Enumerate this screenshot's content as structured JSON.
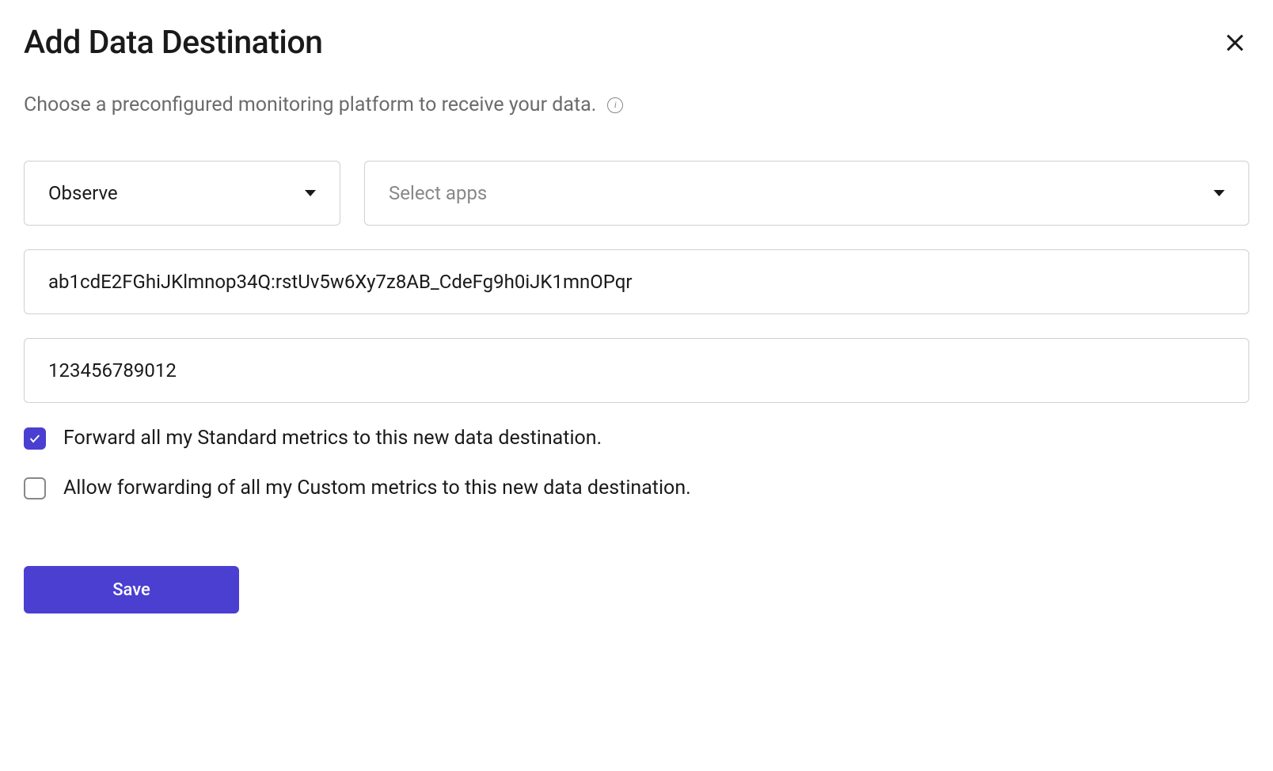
{
  "modal": {
    "title": "Add Data Destination",
    "subtitle": "Choose a preconfigured monitoring platform to receive your data.",
    "platform_select": {
      "value": "Observe"
    },
    "apps_select": {
      "placeholder": "Select apps"
    },
    "api_key_input": {
      "value": "ab1cdE2FGhiJKlmnop34Q:rstUv5w6Xy7z8AB_CdeFg9h0iJK1mnOPqr"
    },
    "account_id_input": {
      "value": "123456789012"
    },
    "checkbox_standard": {
      "label": "Forward all my Standard metrics to this new data destination.",
      "checked": true
    },
    "checkbox_custom": {
      "label": "Allow forwarding of all my Custom metrics to this new data destination.",
      "checked": false
    },
    "save_button_label": "Save"
  }
}
